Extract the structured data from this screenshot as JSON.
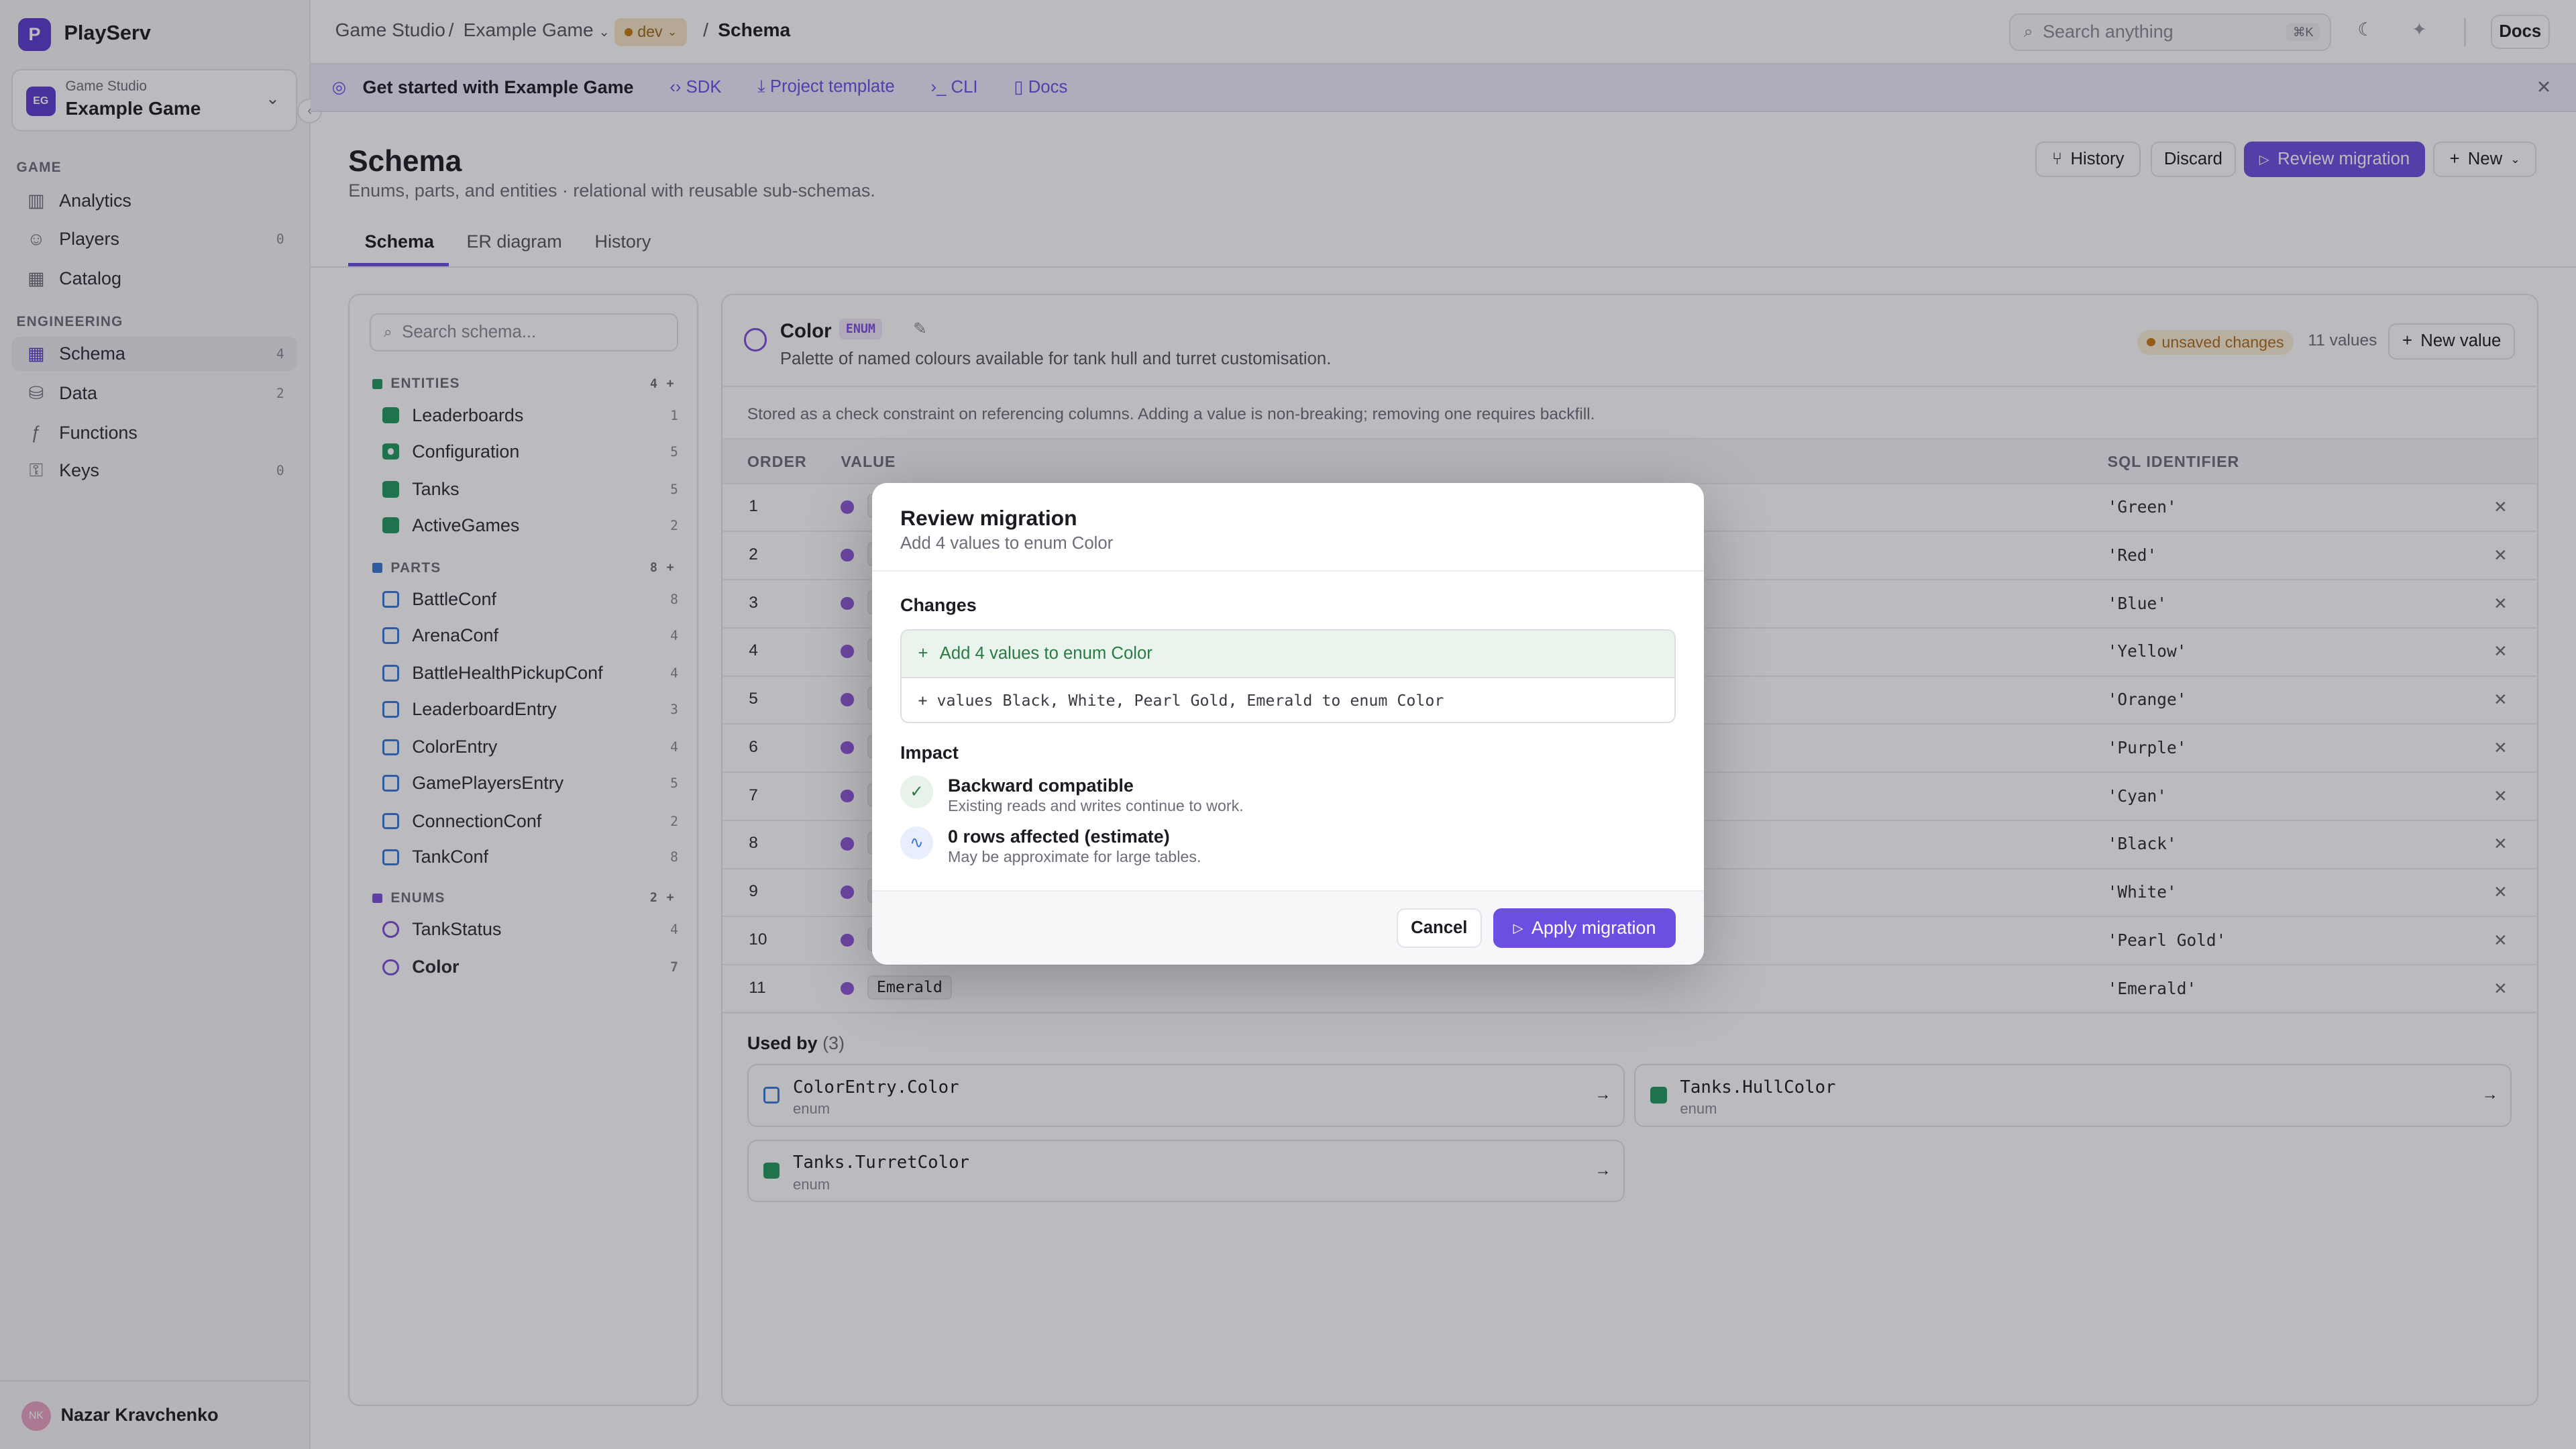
{
  "app": {
    "name": "PlayServ",
    "logo_letter": "P"
  },
  "project": {
    "org": "Game Studio",
    "name": "Example Game",
    "badge": "EG"
  },
  "nav": {
    "game_section": "GAME",
    "game_items": [
      {
        "label": "Analytics",
        "icon": "bar-chart-icon",
        "count": ""
      },
      {
        "label": "Players",
        "icon": "user-icon",
        "count": "0"
      },
      {
        "label": "Catalog",
        "icon": "grid-icon",
        "count": ""
      }
    ],
    "eng_section": "ENGINEERING",
    "eng_items": [
      {
        "label": "Schema",
        "icon": "grid-icon",
        "count": "4"
      },
      {
        "label": "Data",
        "icon": "database-icon",
        "count": "2"
      },
      {
        "label": "Functions",
        "icon": "function-icon",
        "count": ""
      },
      {
        "label": "Keys",
        "icon": "key-icon",
        "count": "0"
      }
    ]
  },
  "user": {
    "name": "Nazar Kravchenko",
    "initials": "NK"
  },
  "breadcrumb": {
    "org": "Game Studio",
    "sep": "/",
    "project": "Example Game",
    "env": "dev",
    "page": "Schema"
  },
  "topbar": {
    "search_placeholder": "Search anything",
    "search_kbd": "⌘K",
    "docs": "Docs"
  },
  "banner": {
    "title": "Get started with Example Game",
    "links": [
      "SDK",
      "Project template",
      "CLI",
      "Docs"
    ]
  },
  "page": {
    "title": "Schema",
    "subtitle": "Enums, parts, and entities · relational with reusable sub-schemas.",
    "actions": {
      "history": "History",
      "discard": "Discard",
      "review": "Review migration",
      "new": "New"
    },
    "tabs": [
      "Schema",
      "ER diagram",
      "History"
    ]
  },
  "tree": {
    "search_placeholder": "Search schema...",
    "entities": {
      "label": "ENTITIES",
      "count": "4",
      "items": [
        {
          "name": "Leaderboards",
          "count": "1"
        },
        {
          "name": "Configuration",
          "count": "5"
        },
        {
          "name": "Tanks",
          "count": "5"
        },
        {
          "name": "ActiveGames",
          "count": "2"
        }
      ]
    },
    "parts": {
      "label": "PARTS",
      "count": "8",
      "items": [
        {
          "name": "BattleConf",
          "count": "8"
        },
        {
          "name": "ArenaConf",
          "count": "4"
        },
        {
          "name": "BattleHealthPickupConf",
          "count": "4"
        },
        {
          "name": "LeaderboardEntry",
          "count": "3"
        },
        {
          "name": "ColorEntry",
          "count": "4"
        },
        {
          "name": "GamePlayersEntry",
          "count": "5"
        },
        {
          "name": "ConnectionConf",
          "count": "2"
        },
        {
          "name": "TankConf",
          "count": "8"
        }
      ]
    },
    "enums": {
      "label": "ENUMS",
      "count": "2",
      "items": [
        {
          "name": "TankStatus",
          "count": "4"
        },
        {
          "name": "Color",
          "count": "7"
        }
      ]
    }
  },
  "enum": {
    "name": "Color",
    "kind": "ENUM",
    "description": "Palette of named colours available for tank hull and turret customisation.",
    "badge": "unsaved changes",
    "value_count": "11 values",
    "new_value": "New value",
    "note": "Stored as a check constraint on referencing columns. Adding a value is non-breaking; removing one requires backfill.",
    "columns": {
      "order": "ORDER",
      "value": "VALUE",
      "sql": "SQL IDENTIFIER"
    },
    "rows": [
      {
        "order": "1",
        "value": "Green",
        "sql": "'Green'"
      },
      {
        "order": "2",
        "value": "Red",
        "sql": "'Red'"
      },
      {
        "order": "3",
        "value": "Blue",
        "sql": "'Blue'"
      },
      {
        "order": "4",
        "value": "Yellow",
        "sql": "'Yellow'"
      },
      {
        "order": "5",
        "value": "Orange",
        "sql": "'Orange'"
      },
      {
        "order": "6",
        "value": "Purple",
        "sql": "'Purple'"
      },
      {
        "order": "7",
        "value": "Cyan",
        "sql": "'Cyan'"
      },
      {
        "order": "8",
        "value": "Black",
        "sql": "'Black'"
      },
      {
        "order": "9",
        "value": "White",
        "sql": "'White'"
      },
      {
        "order": "10",
        "value": "Pearl Gold",
        "sql": "'Pearl Gold'"
      },
      {
        "order": "11",
        "value": "Emerald",
        "sql": "'Emerald'"
      }
    ],
    "used_by": {
      "label": "Used by",
      "count": "(3)",
      "items": [
        {
          "name": "ColorEntry.Color",
          "type": "enum",
          "kind": "part"
        },
        {
          "name": "Tanks.HullColor",
          "type": "enum",
          "kind": "entity"
        },
        {
          "name": "Tanks.TurretColor",
          "type": "enum",
          "kind": "entity"
        }
      ]
    }
  },
  "modal": {
    "title": "Review migration",
    "subtitle": "Add 4 values to enum Color",
    "changes_label": "Changes",
    "change_summary": "Add 4 values to enum Color",
    "change_detail": "+ values Black, White, Pearl Gold, Emerald to enum Color",
    "impact_label": "Impact",
    "impacts": [
      {
        "title": "Backward compatible",
        "desc": "Existing reads and writes continue to work."
      },
      {
        "title": "0 rows affected (estimate)",
        "desc": "May be approximate for large tables."
      }
    ],
    "cancel": "Cancel",
    "apply": "Apply migration"
  },
  "colors": {
    "accent": "#6c4ee0",
    "entity": "#1f9a5c",
    "part": "#3a78d4",
    "enum": "#7c4fd6",
    "warn": "#c67a12"
  }
}
